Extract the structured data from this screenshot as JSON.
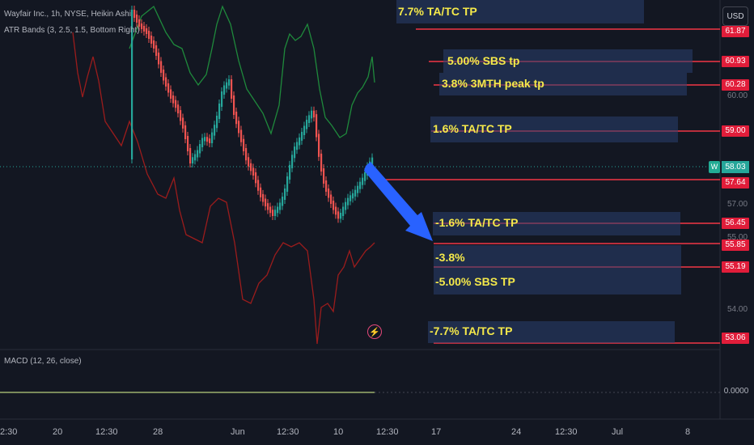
{
  "legend": {
    "title": "Wayfair Inc., 1h, NYSE, Heikin Ashi",
    "indicator": "ATR Bands (3, 2.5, 1.5, Bottom Right)",
    "macd": "MACD (12, 26, close)"
  },
  "currency": "USD",
  "price_axis": [
    "60.00",
    "57.00",
    "55.00",
    "54.00"
  ],
  "price_tags": [
    "61.87",
    "60.93",
    "60.28",
    "59.00",
    "57.64",
    "56.45",
    "55.85",
    "55.19",
    "53.06"
  ],
  "last_price": {
    "badge": "W",
    "value": "58.03"
  },
  "macd_zero": "0.0000",
  "targets": [
    "7.7% TA/TC TP",
    "5.00% SBS tp",
    "3.8% 3MTH peak tp",
    "1.6% TA/TC TP",
    "-1.6% TA/TC TP",
    "-3.8%",
    "-5.00% SBS TP",
    "-7.7% TA/TC TP"
  ],
  "time_axis": [
    "2:30",
    "20",
    "12:30",
    "28",
    "Jun",
    "12:30",
    "10",
    "12:30",
    "17",
    "24",
    "12:30",
    "Jul",
    "8"
  ],
  "colors": {
    "background": "#131722",
    "bull_candle": "#26a69a",
    "bear_candle": "#ef5350",
    "upper_band": "#1f8a3c",
    "lower_band": "#9b1c1c",
    "target_line": "#f23645",
    "target_box": "#2a4070",
    "target_text": "#f5e94a",
    "arrow": "#2962ff"
  }
}
